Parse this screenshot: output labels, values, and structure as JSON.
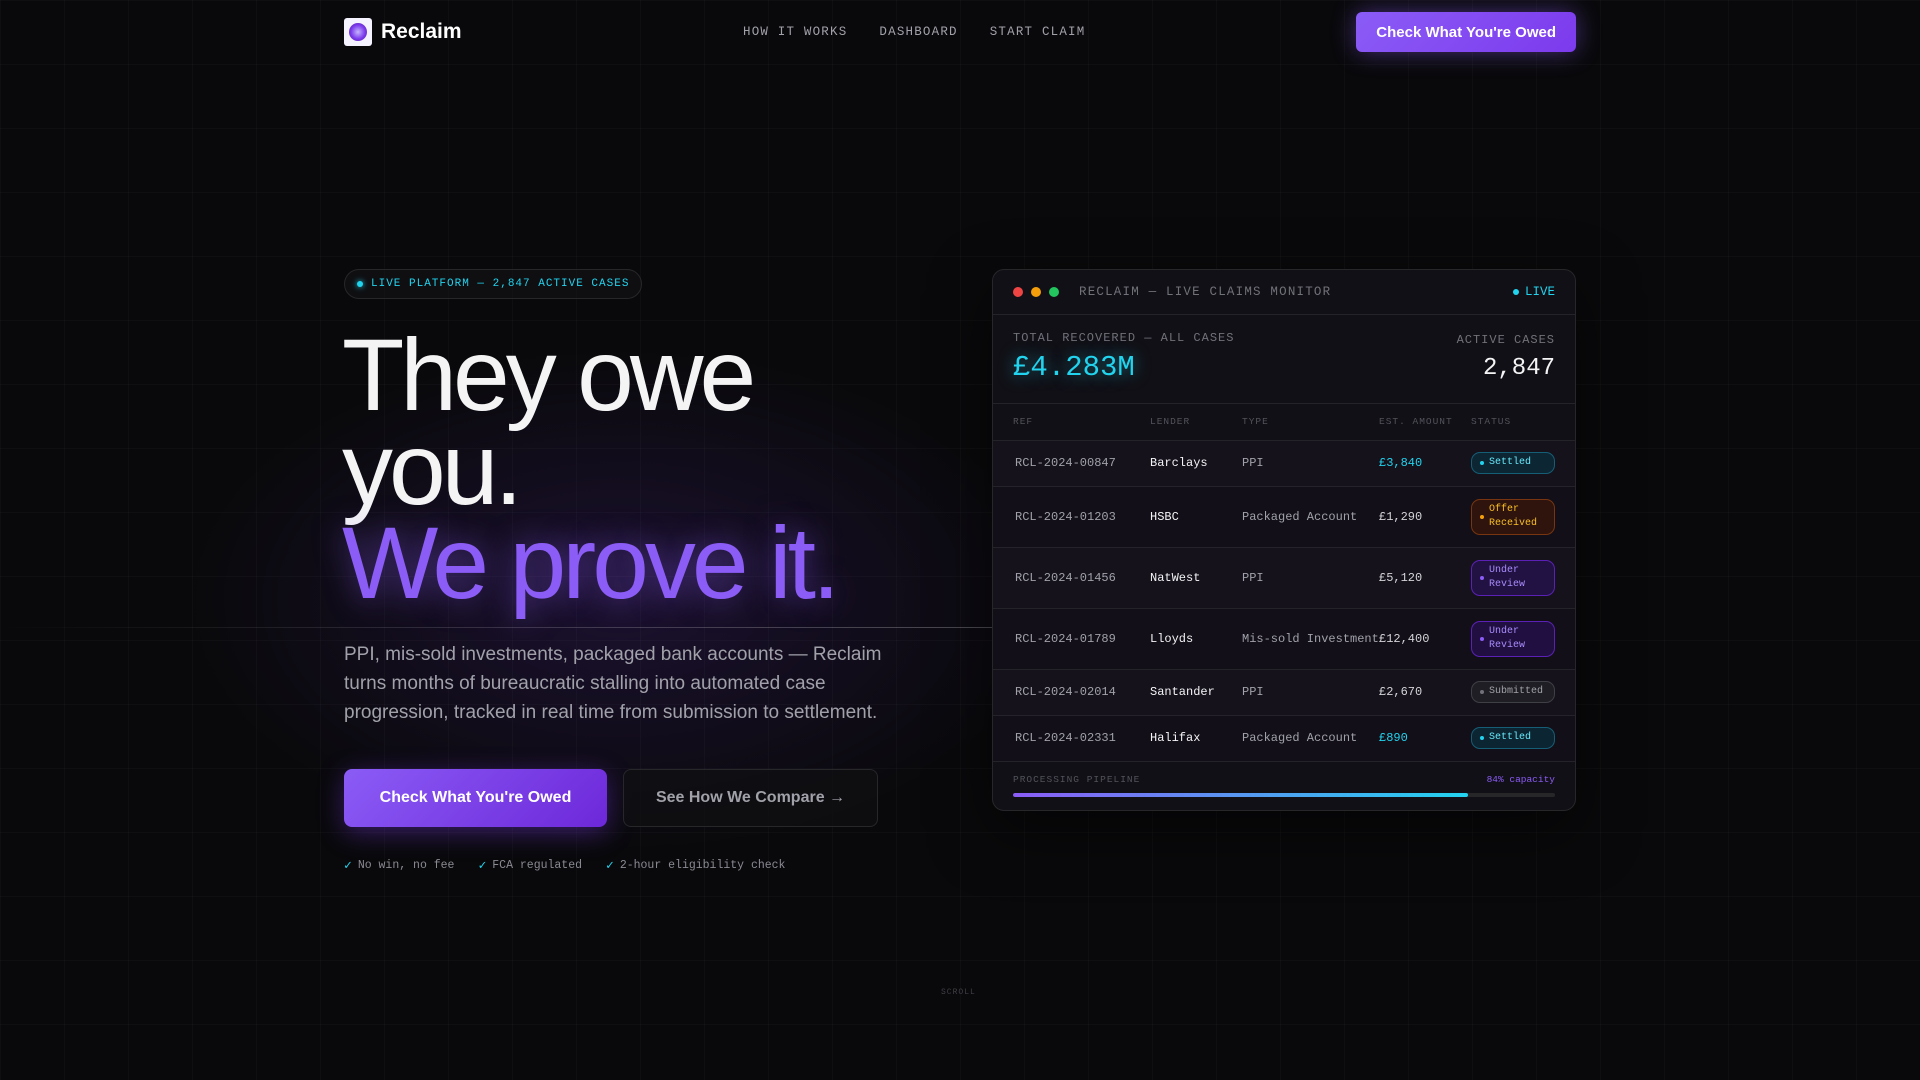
{
  "brand": {
    "name": "Reclaim",
    "logo_icon": "orb-logo-icon"
  },
  "nav": {
    "links": [
      "HOW IT WORKS",
      "DASHBOARD",
      "START CLAIM"
    ],
    "cta_label": "Check What You're Owed"
  },
  "hero": {
    "pill_text": "LIVE PLATFORM — 2,847 ACTIVE CASES",
    "headline_line1": "They owe",
    "headline_line2": "you.",
    "headline_line3": "We prove it.",
    "description": "PPI, mis-sold investments, packaged bank accounts — Reclaim turns months of bureaucratic stalling into automated case progression, tracked in real time from submission to settlement.",
    "primary_cta": "Check What You're Owed",
    "secondary_cta": "See How We Compare →",
    "trust_items": [
      "No win, no fee",
      "FCA regulated",
      "2-hour eligibility check"
    ]
  },
  "monitor": {
    "title": "RECLAIM — LIVE CLAIMS MONITOR",
    "live_label": "LIVE",
    "total_label": "TOTAL RECOVERED — ALL CASES",
    "total_value": "£4.283M",
    "active_label": "ACTIVE CASES",
    "active_value": "2,847",
    "columns": [
      "REF",
      "LENDER",
      "TYPE",
      "EST. AMOUNT",
      "STATUS"
    ],
    "rows": [
      {
        "ref": "RCL-2024-00847",
        "lender": "Barclays",
        "type": "PPI",
        "amount": "£3,840",
        "status": "Settled",
        "status_kind": "settled"
      },
      {
        "ref": "RCL-2024-01203",
        "lender": "HSBC",
        "type": "Packaged Account",
        "amount": "£1,290",
        "status": "Offer Received",
        "status_kind": "offer"
      },
      {
        "ref": "RCL-2024-01456",
        "lender": "NatWest",
        "type": "PPI",
        "amount": "£5,120",
        "status": "Under Review",
        "status_kind": "review"
      },
      {
        "ref": "RCL-2024-01789",
        "lender": "Lloyds",
        "type": "Mis-sold Investment",
        "amount": "£12,400",
        "status": "Under Review",
        "status_kind": "review"
      },
      {
        "ref": "RCL-2024-02014",
        "lender": "Santander",
        "type": "PPI",
        "amount": "£2,670",
        "status": "Submitted",
        "status_kind": "submitted"
      },
      {
        "ref": "RCL-2024-02331",
        "lender": "Halifax",
        "type": "Packaged Account",
        "amount": "£890",
        "status": "Settled",
        "status_kind": "settled"
      }
    ],
    "pipeline_label": "PROCESSING PIPELINE",
    "pipeline_capacity_label": "84% capacity",
    "pipeline_fraction": 0.84
  },
  "scroll_label": "SCROLL",
  "colors": {
    "accent_purple": "#8b5cf6",
    "accent_cyan": "#22d3ee",
    "status_settled": "#22d3ee",
    "status_offer": "#f59e0b",
    "status_review": "#8b5cf6",
    "status_submitted": "#71717a",
    "window_dots": [
      "#ef4444",
      "#f59e0b",
      "#22c55e"
    ]
  }
}
